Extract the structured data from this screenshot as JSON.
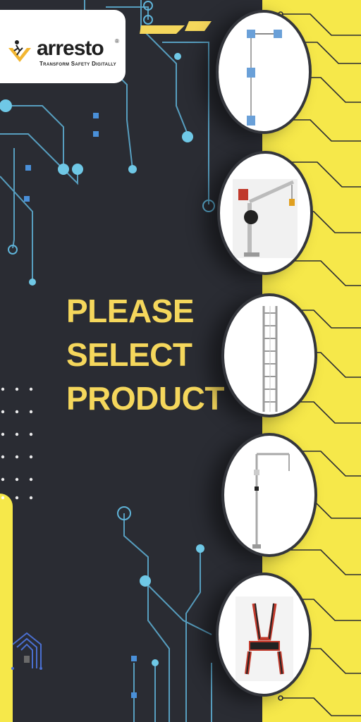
{
  "brand": {
    "name": "arresto",
    "registered": "®",
    "tagline": "Transform Safety Digitally"
  },
  "headline": {
    "line1": "PLEASE",
    "line2": "SELECT",
    "line3": "PRODUCT"
  },
  "colors": {
    "background": "#2a2c33",
    "accent_yellow": "#f6e84a",
    "headline": "#f5d75c",
    "circuit_blue": "#6fc8e6"
  },
  "products": [
    {
      "icon": "lifeline-anchor-system-icon"
    },
    {
      "icon": "davit-arm-crane-icon"
    },
    {
      "icon": "vertical-ladder-system-icon"
    },
    {
      "icon": "davit-post-icon"
    },
    {
      "icon": "full-body-harness-icon"
    }
  ],
  "decor": {
    "house_icon": "smart-building-icon"
  }
}
